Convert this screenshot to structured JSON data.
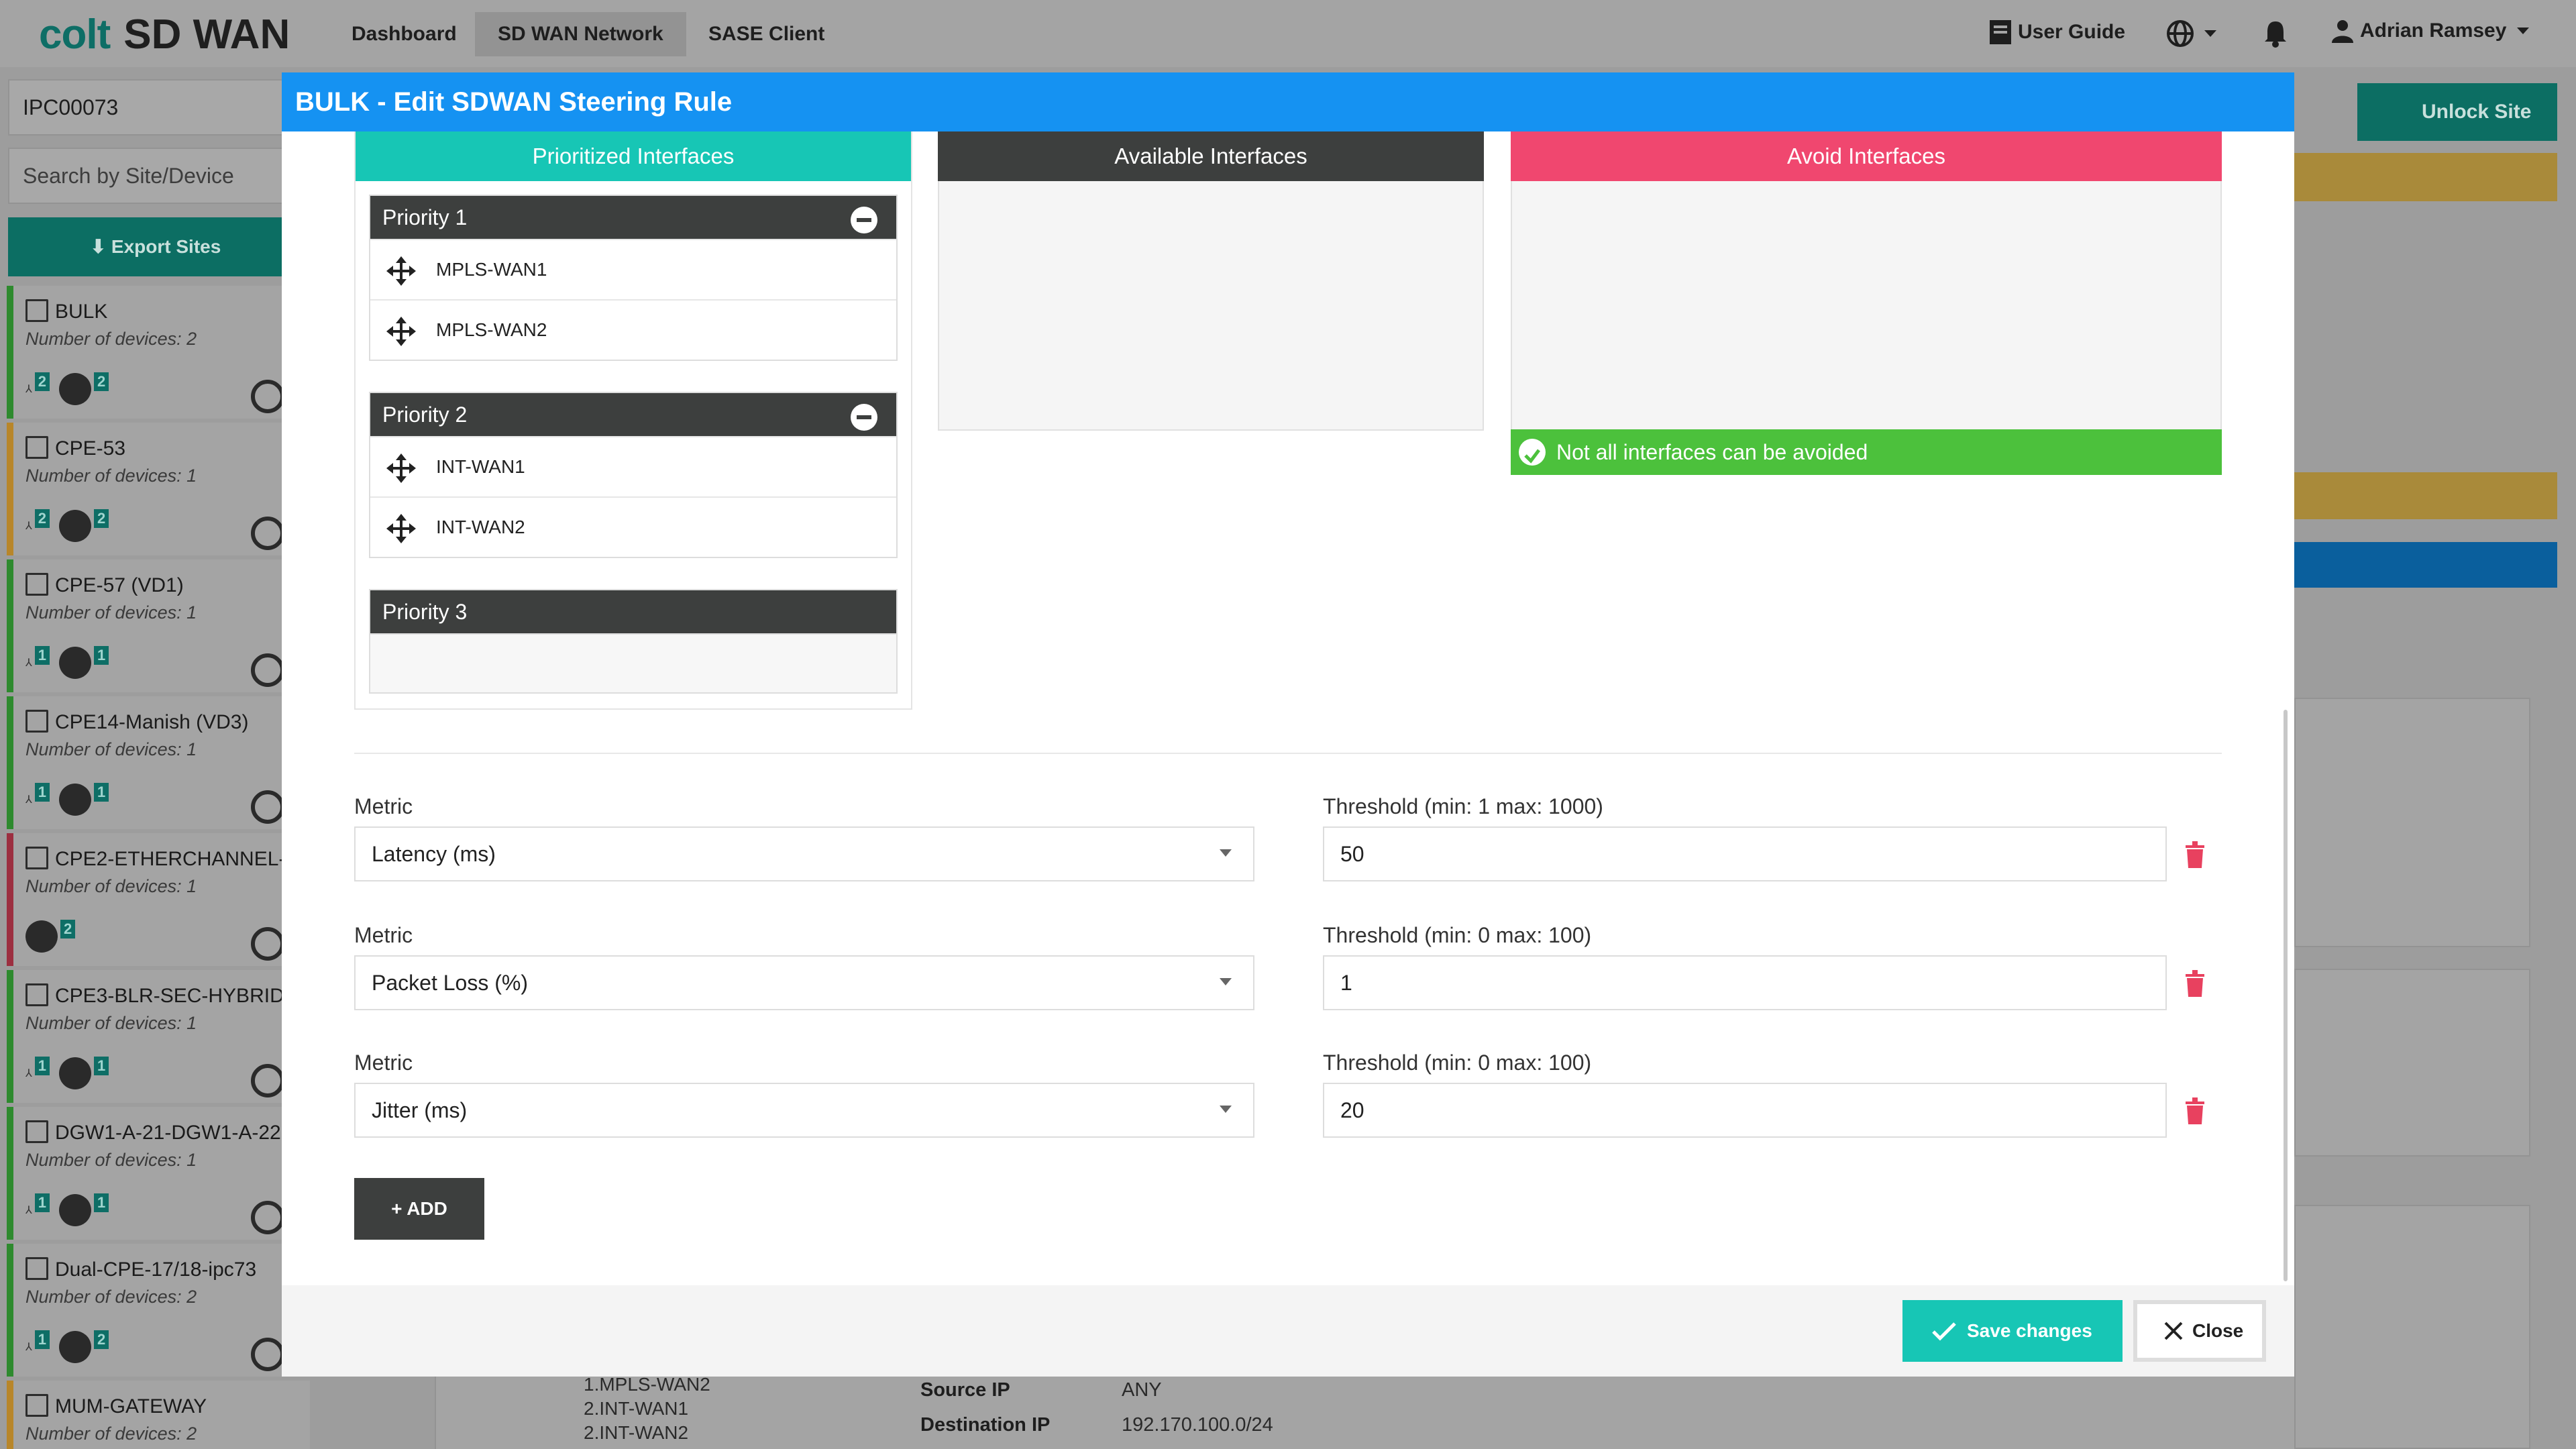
{
  "app": {
    "logo_brand": "colt",
    "logo_product": "SD WAN"
  },
  "nav": {
    "tabs": [
      {
        "label": "Dashboard"
      },
      {
        "label": "SD WAN Network"
      },
      {
        "label": "SASE Client"
      }
    ],
    "user_guide": "User Guide",
    "user": "Adrian Ramsey"
  },
  "sidebar": {
    "site_filter": "IPC00073",
    "search_placeholder": "Search by Site/Device",
    "export_label": "Export Sites",
    "sites": [
      {
        "name": "BULK",
        "devices": "Number of devices: 2",
        "b1": "2",
        "b2": "2"
      },
      {
        "name": "CPE-53",
        "devices": "Number of devices: 1",
        "b1": "2",
        "b2": "2"
      },
      {
        "name": "CPE-57 (VD1)",
        "devices": "Number of devices: 1",
        "b1": "1",
        "b2": "1"
      },
      {
        "name": "CPE14-Manish (VD3)",
        "devices": "Number of devices: 1",
        "b1": "1",
        "b2": "1"
      },
      {
        "name": "CPE2-ETHERCHANNEL-",
        "devices": "Number of devices: 1",
        "b1": "",
        "b2": "2"
      },
      {
        "name": "CPE3-BLR-SEC-HYBRID",
        "devices": "Number of devices: 1",
        "b1": "1",
        "b2": "1"
      },
      {
        "name": "DGW1-A-21-DGW1-A-22",
        "devices": "Number of devices: 1",
        "b1": "1",
        "b2": "1"
      },
      {
        "name": "Dual-CPE-17/18-ipc73",
        "devices": "Number of devices: 2",
        "b1": "1",
        "b2": "2"
      },
      {
        "name": "MUM-GATEWAY",
        "devices": "Number of devices: 2",
        "b1": "",
        "b2": ""
      }
    ]
  },
  "background": {
    "unlock_label": "Unlock Site",
    "rule_detail": {
      "paths": [
        "1.MPLS-WAN2",
        "2.INT-WAN1",
        "2.INT-WAN2"
      ],
      "source_ip_label": "Source IP",
      "source_ip": "ANY",
      "dest_ip_label": "Destination IP",
      "dest_ip": "192.170.100.0/24"
    }
  },
  "modal": {
    "title": "BULK - Edit SDWAN Steering Rule",
    "columns": {
      "prioritized": "Prioritized Interfaces",
      "available": "Available Interfaces",
      "avoid": "Avoid Interfaces"
    },
    "priorities": [
      {
        "label": "Priority 1",
        "interfaces": [
          "MPLS-WAN1",
          "MPLS-WAN2"
        ]
      },
      {
        "label": "Priority 2",
        "interfaces": [
          "INT-WAN1",
          "INT-WAN2"
        ]
      },
      {
        "label": "Priority 3",
        "interfaces": []
      }
    ],
    "avoid_status": "Not all interfaces can be avoided",
    "metrics": [
      {
        "label": "Metric",
        "value": "Latency (ms)",
        "threshold_label": "Threshold (min: 1 max: 1000)",
        "threshold": "50"
      },
      {
        "label": "Metric",
        "value": "Packet Loss (%)",
        "threshold_label": "Threshold (min: 0 max: 100)",
        "threshold": "1"
      },
      {
        "label": "Metric",
        "value": "Jitter (ms)",
        "threshold_label": "Threshold (min: 0 max: 100)",
        "threshold": "20"
      }
    ],
    "add_label": "ADD",
    "save_label": "Save changes",
    "close_label": "Close"
  },
  "colors": {
    "header": "#1592f2",
    "prioritized": "#17c6b5",
    "available": "#3d3f3e",
    "avoid": "#f0476f",
    "success": "#4cc13c",
    "trash": "#e8415f"
  }
}
